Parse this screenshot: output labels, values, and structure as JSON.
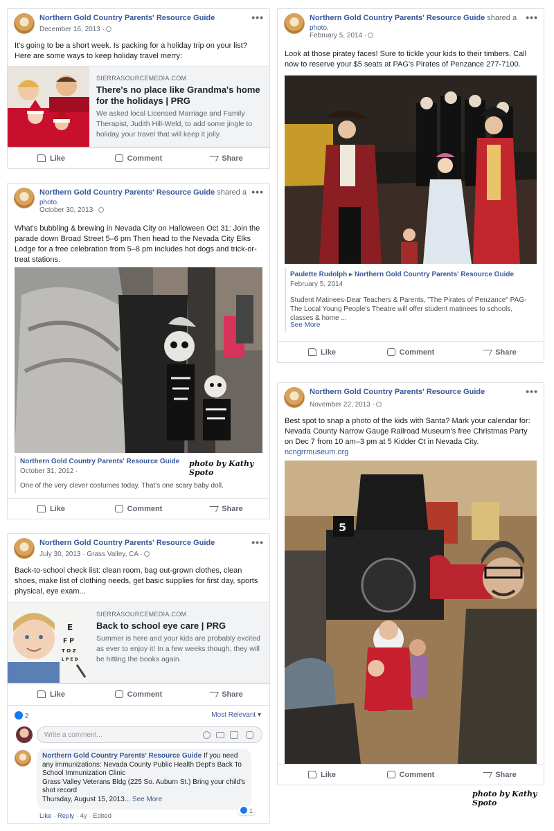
{
  "page_name": "Northern Gold Country Parents' Resource Guide",
  "actions": {
    "like": "Like",
    "comment": "Comment",
    "share": "Share"
  },
  "more": "•••",
  "posts": {
    "holiday": {
      "date": "December 16, 2013 ·",
      "text": "It's going to be a short week. Is packing for a holiday trip on your list? Here are some ways to keep holiday travel merry:",
      "link_domain": "SIERRASOURCEMEDIA.COM",
      "link_title": "There's no place like Grandma's home for the holidays | PRG",
      "link_desc": "We asked local Licensed Marriage and Family Therapist, Judith Hill-Weld, to add some jingle to holiday your travel that will keep it jolly."
    },
    "halloween": {
      "shared": "shared a",
      "photo_word": "photo.",
      "date": "October 30, 2013 ·",
      "text": "What's bubbling & brewing in Nevada City on Halloween Oct 31: Join the parade down Broad Street 5–6 pm Then head to the Nevada City Elks Lodge for a free celebration from 5–8 pm includes hot dogs and trick-or-treat stations.",
      "sub_attrib": "Northern Gold Country Parents' Resource Guide",
      "sub_date": "October 31, 2012 ·",
      "sub_text": "One of the very clever costumes today. That's one scary baby doll.",
      "credit": "photo by Kathy Spoto"
    },
    "school": {
      "date": "July 30, 2013 · Grass Valley, CA ·",
      "text": "Back-to-school check list: clean room, bag out-grown clothes, clean shoes, make list of clothing needs, get basic supplies for first day, sports physical, eye exam...",
      "link_domain": "SIERRASOURCEMEDIA.COM",
      "link_title": "Back to school eye care | PRG",
      "link_desc": "Summer is here and your kids are probably excited as ever to enjoy it! In a few weeks though, they will be hitting the books again.",
      "reactions_count": "2",
      "most_relevant": "Most Relevant ▾",
      "comment_placeholder": "Write a comment...",
      "comment_author": "Northern Gold Country Parents' Resource Guide",
      "comment_text_1": " If you need any immunizations: Nevada County Public Health Dept's Back To School Immunization Clinic",
      "comment_text_2": "Grass Valley Veterans Bldg (225 So. Auburn St.) Bring your child's shot record",
      "comment_text_3": "Thursday, August 15, 2013...",
      "see_more": "See More",
      "comment_like": "Like",
      "comment_reply": "Reply",
      "comment_age": "4y",
      "comment_edited": "Edited",
      "comment_reactions": "1"
    },
    "pirates": {
      "shared": "shared a",
      "photo_word": "photo.",
      "date": "February 5, 2014 ·",
      "text": "Look at those piratey faces! Sure to tickle your kids to their timbers. Call now to reserve your $5 seats at PAG's Pirates of Penzance 277-7100.",
      "sub_attrib_from": "Paulette Rudolph",
      "sub_attrib_to": "Northern Gold Country Parents' Resource Guide",
      "sub_date": "February 5, 2014",
      "sub_text": "Student Matinees-Dear Teachers & Parents, \"The Pirates of Penzance\" PAG-The Local Young People's Theatre will offer student matinees to schools, classes & home ...",
      "see_more": "See More"
    },
    "santa": {
      "date": "November 22, 2013 ·",
      "text": "Best spot to snap a photo of the kids with Santa? Mark your calendar for: Nevada County Narrow Gauge Railroad Museum's free Christmas Party on Dec 7 from 10 am–3 pm at 5 Kidder Ct in Nevada City.",
      "link": "ncngrrmuseum.org",
      "credit": "photo by Kathy Spoto"
    }
  }
}
